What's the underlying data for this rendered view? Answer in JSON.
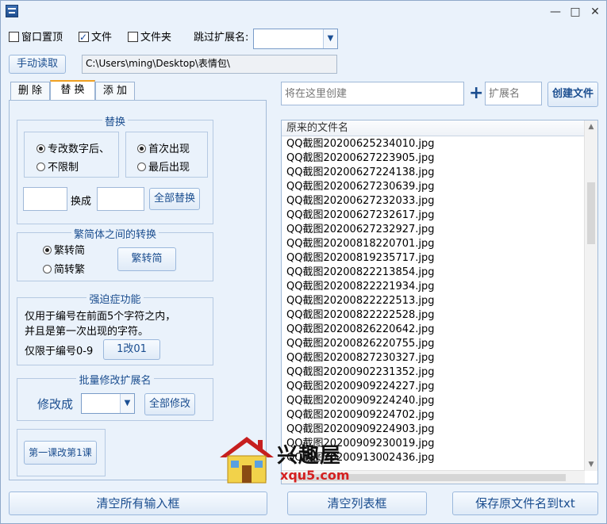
{
  "titlebar": {
    "minimize": "—",
    "maximize": "□",
    "close": "✕"
  },
  "options": {
    "window_top": {
      "label": "窗口置顶",
      "checked": false
    },
    "file": {
      "label": "文件",
      "checked": true
    },
    "folder": {
      "label": "文件夹",
      "checked": false
    },
    "skip_ext_label": "跳过扩展名:",
    "skip_ext_value": ""
  },
  "toolbar": {
    "manual_read": "手动读取",
    "path": "C:\\Users\\ming\\Desktop\\表情包\\"
  },
  "tabs": [
    {
      "label": "删 除",
      "active": false
    },
    {
      "label": "替 换",
      "active": true
    },
    {
      "label": "添 加",
      "active": false
    }
  ],
  "replace_group": {
    "title": "替换",
    "radio_after_number": "专改数字后、",
    "radio_unlimited": "不限制",
    "radio_first": "首次出现",
    "radio_last": "最后出现",
    "change_to": "换成",
    "replace_all": "全部替换"
  },
  "convert_group": {
    "title": "繁简体之间的转换",
    "radio_trad_to_simp": "繁转简",
    "radio_simp_to_trad": "简转繁",
    "convert_button": "繁转简"
  },
  "ocd_group": {
    "title": "强迫症功能",
    "desc_line1": "仅用于编号在前面5个字符之内，",
    "desc_line2": "并且是第一次出现的字符。",
    "limit_label": "仅限于编号0-9",
    "button": "1改01"
  },
  "ext_group": {
    "title": "批量修改扩展名",
    "change_to": "修改成",
    "modify_all": "全部修改"
  },
  "lesson_button": "第一课改第1课",
  "create": {
    "name_placeholder": "将在这里创建",
    "plus": "+",
    "ext_placeholder": "扩展名",
    "create_button": "创建文件"
  },
  "file_list": {
    "header": "原来的文件名",
    "rows": [
      "QQ截图20200625234010.jpg",
      "QQ截图20200627223905.jpg",
      "QQ截图20200627224138.jpg",
      "QQ截图20200627230639.jpg",
      "QQ截图20200627232033.jpg",
      "QQ截图20200627232617.jpg",
      "QQ截图20200627232927.jpg",
      "QQ截图20200818220701.jpg",
      "QQ截图20200819235717.jpg",
      "QQ截图20200822213854.jpg",
      "QQ截图20200822221934.jpg",
      "QQ截图20200822222513.jpg",
      "QQ截图20200822222528.jpg",
      "QQ截图20200826220642.jpg",
      "QQ截图20200826220755.jpg",
      "QQ截图20200827230327.jpg",
      "QQ截图20200902231352.jpg",
      "QQ截图20200909224227.jpg",
      "QQ截图20200909224240.jpg",
      "QQ截图20200909224702.jpg",
      "QQ截图20200909224903.jpg",
      "QQ截图20200909230019.jpg",
      "QQ截图20200913002436.jpg"
    ]
  },
  "bottom": {
    "clear_inputs": "清空所有输入框",
    "clear_list": "清空列表框",
    "save_txt": "保存原文件名到txt"
  },
  "watermark": {
    "text": "兴趣屋",
    "url": "xqu5.com"
  },
  "colors": {
    "accent": "#1a4d8f",
    "window_bg": "#eaf2fb",
    "watermark_red": "#d42020"
  }
}
